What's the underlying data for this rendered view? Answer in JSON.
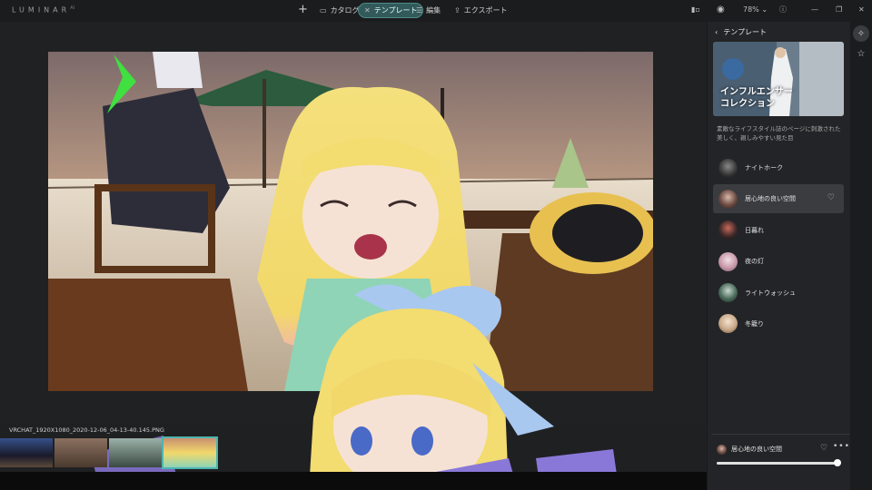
{
  "app": {
    "logo": "LUMINAR",
    "logo_suffix": "AI"
  },
  "nav": {
    "add": "+",
    "tabs": [
      {
        "label": "カタログ",
        "icon": "folder-icon",
        "active": false
      },
      {
        "label": "テンプレート",
        "icon": "template-icon",
        "active": true
      },
      {
        "label": "編集",
        "icon": "sliders-icon",
        "active": false
      },
      {
        "label": "エクスポート",
        "icon": "share-icon",
        "active": false
      }
    ],
    "zoom": "78%"
  },
  "panel": {
    "back_label": "テンプレート",
    "collection_title_line1": "インフルエンサー",
    "collection_title_line2": "コレクション",
    "collection_desc": "素敵なライフスタイル誌のページに刺激された美しく、親しみやすい見た目",
    "templates": [
      {
        "name": "ナイトホーク",
        "selected": false
      },
      {
        "name": "居心地の良い空間",
        "selected": true
      },
      {
        "name": "日暮れ",
        "selected": false
      },
      {
        "name": "夜の灯",
        "selected": false
      },
      {
        "name": "ライトウォッシュ",
        "selected": false
      },
      {
        "name": "冬籠り",
        "selected": false
      }
    ],
    "applied": {
      "name": "居心地の良い空間",
      "amount": 0.98
    }
  },
  "filmstrip": {
    "filename": "VRCHAT_1920X1080_2020-12-06_04-13-40.145.PNG"
  },
  "colors": {
    "accent": "#4fb4b0",
    "tab_active_bg": "#325a5a"
  }
}
